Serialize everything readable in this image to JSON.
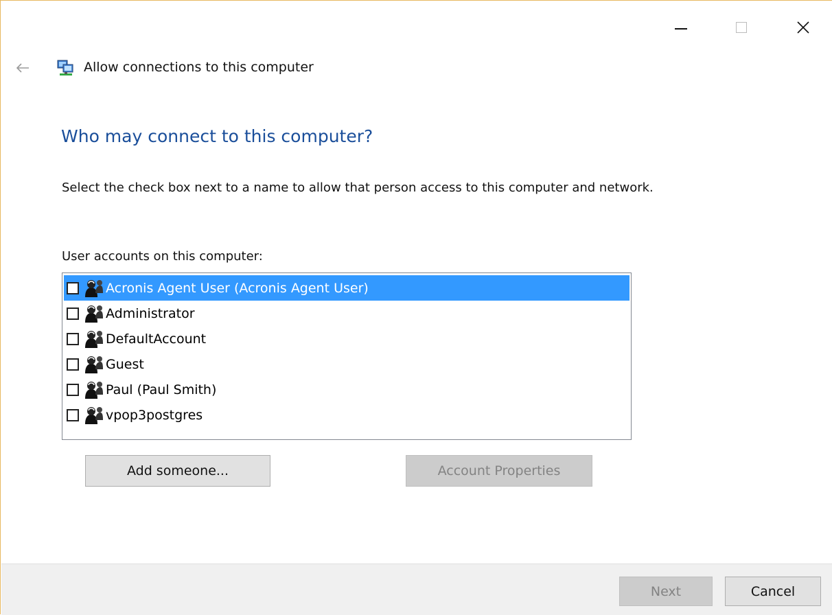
{
  "window": {
    "controls": {
      "minimize_icon": "minimize-icon",
      "maximize_icon": "maximize-icon",
      "close_icon": "close-icon"
    },
    "back_icon": "back-arrow-icon",
    "app_icon": "network-computers-icon",
    "title": "Allow connections to this computer"
  },
  "main": {
    "heading": "Who may connect to this computer?",
    "instructions": "Select the check box next to a name to allow that person access to this computer and network.",
    "list_label": "User accounts on this computer:",
    "users": [
      {
        "name": "Acronis Agent User (Acronis Agent User)",
        "checked": false,
        "selected": true
      },
      {
        "name": "Administrator",
        "checked": false,
        "selected": false
      },
      {
        "name": "DefaultAccount",
        "checked": false,
        "selected": false
      },
      {
        "name": "Guest",
        "checked": false,
        "selected": false
      },
      {
        "name": "Paul (Paul Smith)",
        "checked": false,
        "selected": false
      },
      {
        "name": "vpop3postgres",
        "checked": false,
        "selected": false
      }
    ],
    "add_button": "Add someone...",
    "properties_button": "Account Properties",
    "properties_enabled": false
  },
  "footer": {
    "next_button": "Next",
    "next_enabled": false,
    "cancel_button": "Cancel"
  },
  "colors": {
    "heading": "#1a4e9a",
    "selection": "#3399ff",
    "window_border": "#e8b860"
  }
}
